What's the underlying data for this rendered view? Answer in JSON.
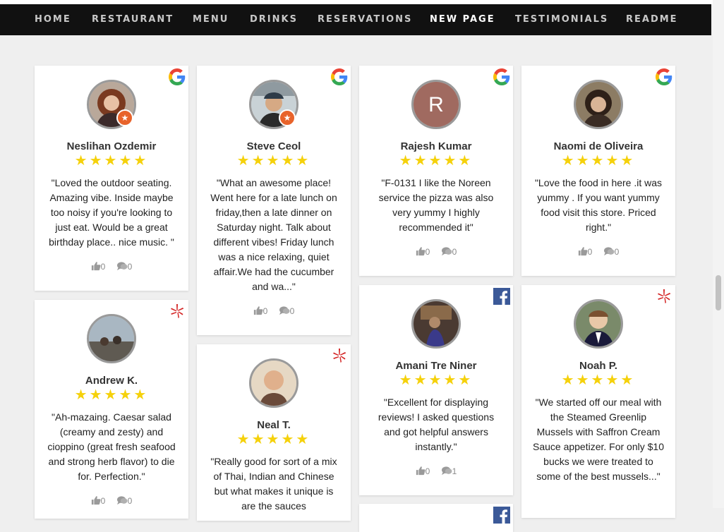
{
  "nav": {
    "items": [
      {
        "label": "HOME"
      },
      {
        "label": "RESTAURANT"
      },
      {
        "label": "MENU"
      },
      {
        "label": "DRINKS"
      },
      {
        "label": "RESERVATIONS"
      },
      {
        "label": "NEW PAGE",
        "active": true
      },
      {
        "label": "TESTIMONIALS"
      },
      {
        "label": "README"
      }
    ]
  },
  "colors": {
    "navbar_bg": "#111111",
    "star": "#f5d10b",
    "yelp_red": "#d32323",
    "facebook_blue": "#3b5998",
    "initial_avatar_bg": "#a06a60"
  },
  "reviews": [
    {
      "name": "Neslihan Ozdemir",
      "source": "google-icon",
      "rating": 5,
      "text": "\"Loved the outdoor seating. Amazing vibe. Inside maybe too noisy if you're looking to just eat. Would be a great birthday place.. nice music. \"",
      "likes": "0",
      "comments": "0"
    },
    {
      "name": "Steve Ceol",
      "source": "google-icon",
      "rating": 5,
      "text": "\"What an awesome place! Went here for a late lunch on friday,then a late dinner on Saturday night. Talk about different vibes! Friday lunch was a nice relaxing, quiet affair.We had the cucumber and wa...\"",
      "likes": "0",
      "comments": "0"
    },
    {
      "name": "Rajesh Kumar",
      "initial": "R",
      "source": "google-icon",
      "rating": 5,
      "text": "\"F-0131 I like the Noreen service the pizza was also very yummy I highly recommended it\"",
      "likes": "0",
      "comments": "0"
    },
    {
      "name": "Naomi de Oliveira",
      "source": "google-icon",
      "rating": 5,
      "text": "\"Love the food in here .it was yummy . If you want yummy food visit this store. Priced right.\"",
      "likes": "0",
      "comments": "0"
    },
    {
      "name": "Andrew K.",
      "source": "yelp-icon",
      "rating": 5,
      "text": "\"Ah-mazaing. Caesar salad (creamy and zesty) and cioppino (great fresh seafood and strong herb flavor) to die for. Perfection.\"",
      "likes": "0",
      "comments": "0"
    },
    {
      "name": "Neal T.",
      "source": "yelp-icon",
      "rating": 5,
      "text": "\"Really good for sort of a mix of Thai, Indian and Chinese but what makes it unique is are the sauces"
    },
    {
      "name": "Amani Tre Niner",
      "source": "facebook-icon",
      "rating": 5,
      "text": "\"Excellent for displaying reviews! I asked questions and got helpful answers instantly.\"",
      "likes": "0",
      "comments": "1"
    },
    {
      "name": "Noah P.",
      "source": "yelp-icon",
      "rating": 5,
      "text": "\"We started off our meal with the Steamed Greenlip Mussels with Saffron Cream Sauce appetizer. For only $10 bucks we were treated to some of the best mussels...\""
    }
  ]
}
